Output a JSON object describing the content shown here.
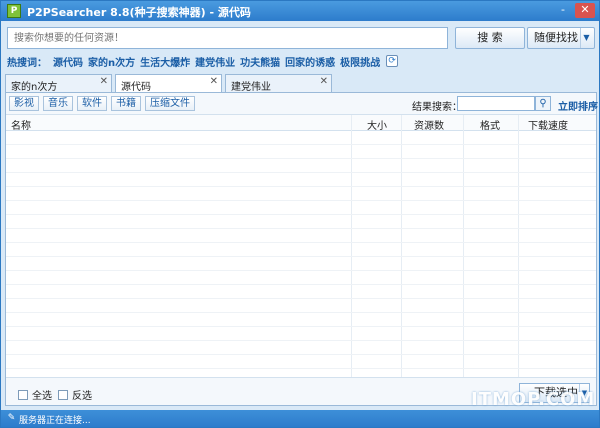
{
  "window": {
    "title": "P2PSearcher 8.8(种子搜索神器) - 源代码",
    "controls": {
      "minimize": "-",
      "close": "✕"
    }
  },
  "search": {
    "placeholder": "搜索你想要的任何资源！",
    "search_button": "搜 索",
    "random_button": "随便找找"
  },
  "hot": {
    "label": "热搜词：",
    "words": [
      "源代码",
      "家的n次方",
      "生活大爆炸",
      "建党伟业",
      "功夫熊猫",
      "回家的诱惑",
      "极限挑战"
    ]
  },
  "tabs": [
    {
      "label": "家的n次方",
      "active": false
    },
    {
      "label": "源代码",
      "active": true
    },
    {
      "label": "建党伟业",
      "active": false
    }
  ],
  "filters": [
    "影视",
    "音乐",
    "软件",
    "书籍",
    "压缩文件"
  ],
  "result_search": {
    "label": "结果搜索：",
    "sort_label": "立即排序"
  },
  "table": {
    "columns": [
      "名称",
      "大小",
      "资源数",
      "格式",
      "下载速度"
    ]
  },
  "bottom": {
    "select_all": "全选",
    "invert": "反选",
    "download_button": "下载选中"
  },
  "status": {
    "text": "服务器正在连接..."
  },
  "watermark": "ITMOP.COM",
  "colors": {
    "accent": "#2d7ccc",
    "link": "#1b5ea6",
    "background": "#d9e9f7"
  }
}
